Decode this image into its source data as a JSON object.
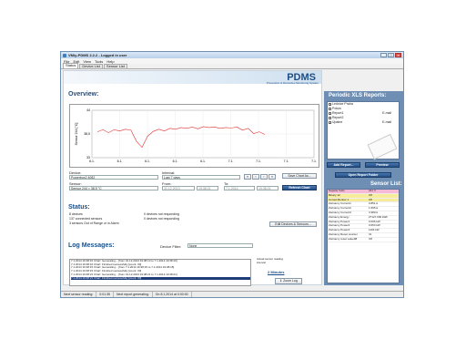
{
  "window": {
    "title": "VMiy-PDMS 2.2.2 - Logged in user"
  },
  "menu": [
    "File",
    "Edit",
    "View",
    "Tools",
    "Help"
  ],
  "tabs": [
    "Status",
    "Device List",
    "Sensor List"
  ],
  "banner": {
    "logo": "PDMS",
    "subtitle": "Prevention & Damocles Monitoring System"
  },
  "overview": {
    "title": "Overview:",
    "ylabel": "Sensor 244 [°C]"
  },
  "chart_data": {
    "type": "line",
    "ylabel": "Sensor 244 [°C]",
    "ylim": [
      33,
      44
    ],
    "yticks": [
      "44",
      "38,5",
      "33"
    ],
    "xticks": [
      "6.1.",
      "6.1.",
      "6.1.",
      "6.1.",
      "6.1.",
      "7.1.",
      "7.1.",
      "7.1.",
      "7.1."
    ],
    "series": [
      {
        "color": "#e03030",
        "values": [
          39,
          39.5,
          38.8,
          39.5,
          39.2,
          39.6,
          39.4,
          36.8,
          35.4,
          38,
          39.1,
          39.6,
          39.2,
          39.8,
          39.6,
          40,
          39.8,
          40.1,
          39.7,
          40.2,
          40,
          40.1,
          39.8,
          40,
          39.9,
          40.1,
          39.4,
          39.8,
          38.6,
          39,
          38.4
        ]
      }
    ]
  },
  "controls": {
    "device_label": "Device:",
    "interval_label": "Interval:",
    "sensor_label": "Sensor:",
    "from_label": "From:",
    "to_label": "To:",
    "device_value": "Powerbox2 4082",
    "interval_value": "Last 7 days",
    "sensor_value": "Sensor 244 = 38.5 °C",
    "from_date": "31.12.2013",
    "from_time": "19:38:21",
    "to_date": "7.1.2014",
    "to_time": "19:38:21",
    "save_chart": "Save Chart As...",
    "refresh_chart": "Refresh Chart"
  },
  "status": {
    "title": "Status:",
    "lines": [
      "8 devices",
      "137 connected sensors",
      "3 sensors Out of Range or in Alarm"
    ],
    "right_lines": [
      "0 devices not responding",
      "0 devices not responding"
    ],
    "edit_button": "Edit Devices & Sensors..."
  },
  "log": {
    "title": "Log Messages:",
    "filter_label": "Device Filter:",
    "filter_value": "None",
    "lines": [
      "7.1.2014 19:38:10 Chart: Generating... [from 31.12.2013 19:38:10 to 7.1.2014 19:38:10]",
      "7.1.2014 19:38:10 Chart: Finished successfully [count: 30]",
      "7.1.2014 19:38:15 Chart: Generating... [from 7.1.2014 19:38:15 to 7.1.2014 19:38:15]",
      "7.1.2014 19:38:15 Chart: Finished successfully [count: 30]",
      "7.1.2014 19:38:21 Chart: Generating... [from 31.12.2013 19:38:21 to 7.1.2014 19:38:21]",
      "7.1.2014 19:38:21 Chart: Finished successfully [count: 30]"
    ],
    "interval_label": "Actual sensor reading interval",
    "interval_value": "2 Minutes",
    "zoom_log": "Zoom Log"
  },
  "reports": {
    "title": "Periodic XLS Reports:",
    "items": [
      {
        "name": "Ledníce Praha",
        "checked": true,
        "mail": ""
      },
      {
        "name": "Pokus",
        "checked": false,
        "mail": ""
      },
      {
        "name": "Report1",
        "checked": true,
        "mail": "E-mail"
      },
      {
        "name": "Report2",
        "checked": false,
        "mail": ""
      },
      {
        "name": "Úpatne",
        "checked": true,
        "mail": "E-mail"
      }
    ],
    "add": "Add Report...",
    "preview": "Preview",
    "open_folder": "Open Report Folder"
  },
  "sensors": {
    "title": "Sensor List:",
    "rows": [
      {
        "name": "Napetie Volts",
        "value": "241 V",
        "state": "alert"
      },
      {
        "name": "Binary 12",
        "value": "Off",
        "state": "warn"
      },
      {
        "name": "Comet Monitor 1",
        "value": "Off",
        "state": "warn"
      },
      {
        "name": "Zaznamy Current1",
        "value": "0.851 A",
        "state": ""
      },
      {
        "name": "Zaznamy Current2",
        "value": "1.695 A",
        "state": ""
      },
      {
        "name": "Zaznamy Current3",
        "value": "3.389 A",
        "state": ""
      },
      {
        "name": "Zaznamy Energy",
        "value": "27127.000 kWh",
        "state": ""
      },
      {
        "name": "Zaznamy Power1",
        "value": "0.096 kW",
        "state": ""
      },
      {
        "name": "Zaznamy Power2",
        "value": "0.653 kW",
        "state": ""
      },
      {
        "name": "Zaznamy Power3",
        "value": "1164 kW",
        "state": ""
      },
      {
        "name": "Zaznamy Reset counter",
        "value": "31",
        "state": ""
      },
      {
        "name": "Zaznamy reset value98",
        "value": "Off",
        "state": ""
      }
    ]
  },
  "statusbar": {
    "next_reading_label": "Next sensor reading:",
    "next_reading": "0:01:35",
    "next_report_label": "Next report generating:",
    "next_report": "On 8.1.2014 at 0:00:00"
  }
}
